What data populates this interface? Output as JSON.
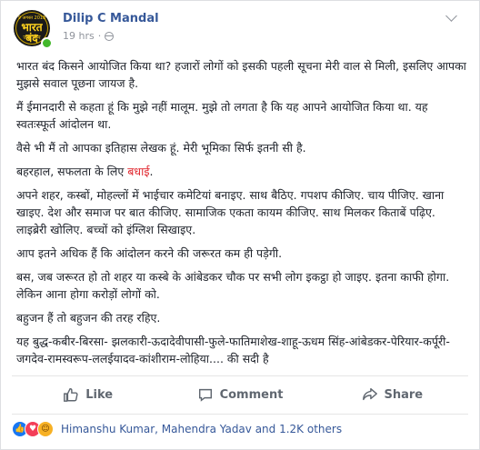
{
  "author": {
    "name": "Dilip C Mandal",
    "time": "19 hrs",
    "avatar_text": [
      "9 अगस्त 2018",
      "भारत बंद",
      "जय भीम"
    ]
  },
  "post": {
    "paragraphs": [
      "भारत बंद किसने आयोजित किया था? हजारों लोगों को इसकी पहली सूचना मेरी वाल से मिली, इसलिए आपका मुझसे सवाल पूछना जायज है.",
      "मैं ईमानदारी से कहता हूं कि मुझे नहीं मालूम. मुझे तो लगता है कि यह आपने आयोजित किया था. यह स्वतःस्फूर्त आंदोलन था.",
      "वैसे भी मैं तो आपका इतिहास लेखक हूं. मेरी भूमिका सिर्फ इतनी सी है.",
      "अपने शहर, कस्बों, मोहल्लों में भाईचार कमेटियां बनाइए. साथ बैठिए. गपशप कीजिए. चाय पीजिए. खाना खाइए. देश और समाज पर बात कीजिए. सामाजिक एकता कायम कीजिए. साथ मिलकर किताबें पढ़िए. लाइब्रेरी खोलिए. बच्चों को इंग्लिश सिखाइए.",
      "आप इतने अधिक हैं कि आंदोलन करने की जरूरत कम ही पड़ेगी.",
      "बस, जब जरूरत हो तो शहर या कस्बे के आंबेडकर चौक पर सभी लोग इकट्ठा हो जाइए. इतना काफी होगा. लेकिन आना होगा करोड़ों लोगों को.",
      "बहुजन हैं तो बहुजन की तरह रहिए.",
      "यह बुद्ध-कबीर-बिरसा- झलकारी-ऊदादेवीपासी-फुले-फातिमाशेख-शाहू-ऊधम सिंह-आंबेडकर-पेरियार-कर्पूरी-जगदेव-रामस्वरूप-ललईयादव-कांशीराम-लोहिया.... की सदी है"
    ],
    "congrats_prefix": "बहरहाल, सफलता के लिए ",
    "congrats_word": "बधाई",
    "congrats_suffix": "."
  },
  "actions": {
    "like": "Like",
    "comment": "Comment",
    "share": "Share"
  },
  "reactions": {
    "summary": "Himanshu Kumar, Mahendra Yadav and 1.2K others",
    "types": [
      "like",
      "love",
      "haha"
    ]
  },
  "colors": {
    "link": "#365899",
    "highlight": "#e0242c",
    "muted": "#90949c"
  }
}
